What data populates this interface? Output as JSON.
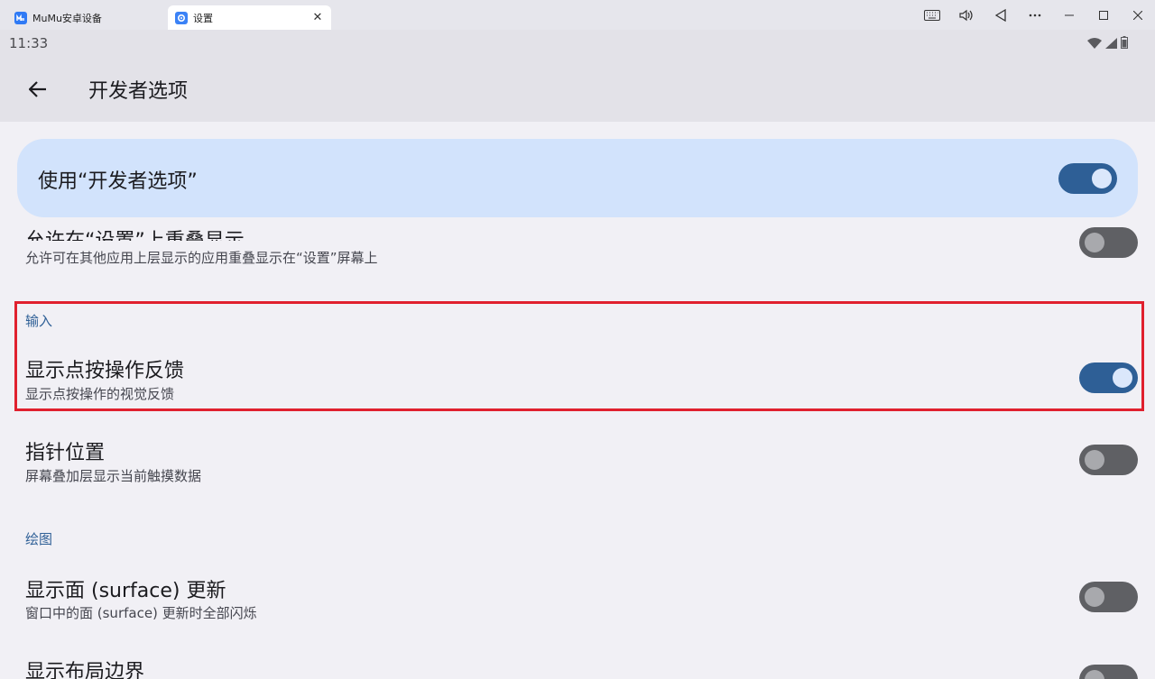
{
  "window": {
    "tabs": [
      {
        "label": "MuMu安卓设备",
        "icon": "mumu-logo-icon"
      },
      {
        "label": "设置",
        "icon": "settings-gear-icon",
        "close": "✕"
      }
    ],
    "controls": [
      "keyboard-icon",
      "volume-icon",
      "back-triangle-icon",
      "more-icon",
      "minimize-icon",
      "maximize-icon",
      "close-icon"
    ]
  },
  "statusbar": {
    "time": "11:33"
  },
  "appbar": {
    "title": "开发者选项"
  },
  "master": {
    "label": "使用“开发者选项”",
    "enabled": true
  },
  "settings": {
    "overlay": {
      "title": "允许在“设置”上重叠显示",
      "subtitle": "允许可在其他应用上层显示的应用重叠显示在“设置”屏幕上",
      "enabled": false
    },
    "input_header": "输入",
    "show_taps": {
      "title": "显示点按操作反馈",
      "subtitle": "显示点按操作的视觉反馈",
      "enabled": true
    },
    "pointer_location": {
      "title": "指针位置",
      "subtitle": "屏幕叠加层显示当前触摸数据",
      "enabled": false
    },
    "drawing_header": "绘图",
    "surface_updates": {
      "title": "显示面 (surface) 更新",
      "subtitle": "窗口中的面 (surface) 更新时全部闪烁",
      "enabled": false
    },
    "layout_bounds": {
      "title": "显示布局边界",
      "enabled": false
    }
  },
  "colors": {
    "accent": "#2e5f96",
    "highlight": "#e0202e",
    "card": "#d2e3fc",
    "background": "#f1f0f5"
  }
}
